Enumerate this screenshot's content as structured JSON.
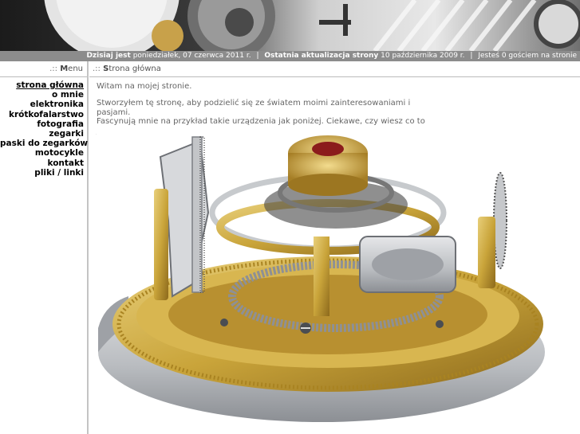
{
  "status": {
    "today_label": "Dzisiaj jest",
    "today_value": "poniedziałek, 07 czerwca 2011 r.",
    "separator": "|",
    "update_label": "Ostatnia aktualizacja strony",
    "update_value": "10 października 2009 r.",
    "visitors_text": "Jesteś 0 gościem na stronie"
  },
  "sidebar": {
    "heading_prefix": ".::",
    "heading_cap": "M",
    "heading_rest": "enu",
    "items": [
      {
        "label": "strona główna",
        "active": true
      },
      {
        "label": "o mnie"
      },
      {
        "label": "elektronika"
      },
      {
        "label": "krótkofalarstwo"
      },
      {
        "label": "fotografia"
      },
      {
        "label": "zegarki"
      },
      {
        "label": "paski do zegarków"
      },
      {
        "label": "motocykle"
      },
      {
        "label": "kontakt"
      },
      {
        "label": "pliki / linki"
      }
    ]
  },
  "main": {
    "heading_prefix": ".::",
    "heading_cap": "S",
    "heading_rest": "trona główna",
    "welcome": "Witam na mojej stronie.",
    "intro_line1": "Stworzyłem tę stronę, aby podzielić się ze światem moimi zainteresowaniami i pasjami.",
    "intro_line2": "Fascynują mnie na przykład takie urządzenia jak poniżej. Ciekawe, czy wiesz co to jest?"
  },
  "colors": {
    "status_bar": "#8c8c8c",
    "divider": "#c4c4c4",
    "brass": "#c9a43a",
    "steel": "#b9bcc0"
  }
}
